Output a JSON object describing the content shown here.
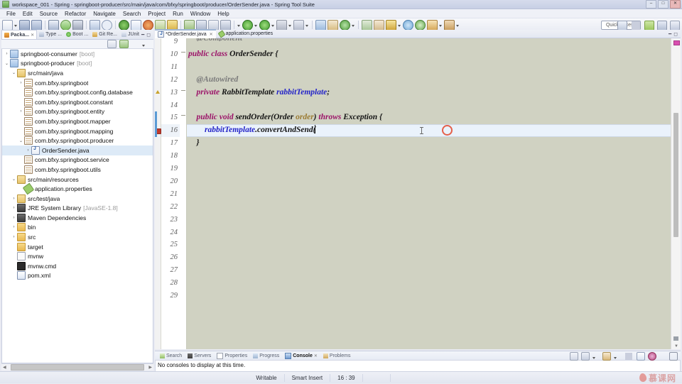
{
  "window": {
    "title": "workspace_001 - Spring - springboot-producer/src/main/java/com/bfxy/springboot/producer/OrderSender.java - Spring Tool Suite",
    "icon": "sts-icon",
    "minimize": "–",
    "maximize": "□",
    "close": "✕"
  },
  "menu": {
    "items": [
      "File",
      "Edit",
      "Source",
      "Refactor",
      "Navigate",
      "Search",
      "Project",
      "Run",
      "Window",
      "Help"
    ]
  },
  "toolbar": {
    "quick_access": "Quick Access"
  },
  "explorer": {
    "tabs": [
      {
        "label": "Packa...",
        "active": true,
        "icon": "package-explorer-icon"
      },
      {
        "label": "Type ...",
        "active": false,
        "icon": "type-hierarchy-icon"
      },
      {
        "label": "Boot ...",
        "active": false,
        "icon": "boot-dashboard-icon"
      },
      {
        "label": "Git Re...",
        "active": false,
        "icon": "git-repositories-icon"
      },
      {
        "label": "JUnit",
        "active": false,
        "icon": "junit-icon"
      }
    ],
    "tree": [
      {
        "indent": 0,
        "twist": "›",
        "icon": "project-icon",
        "label": "springboot-consumer",
        "sub": "[boot]",
        "selected": false
      },
      {
        "indent": 0,
        "twist": "⌄",
        "icon": "project-icon",
        "label": "springboot-producer",
        "sub": "[boot]",
        "selected": false
      },
      {
        "indent": 1,
        "twist": "⌄",
        "icon": "source-folder-icon",
        "label": "src/main/java",
        "sub": "",
        "selected": false
      },
      {
        "indent": 2,
        "twist": "›",
        "icon": "package-icon",
        "label": "com.bfxy.springboot",
        "sub": "",
        "selected": false
      },
      {
        "indent": 2,
        "twist": "",
        "icon": "package-icon",
        "label": "com.bfxy.springboot.config.database",
        "sub": "",
        "selected": false
      },
      {
        "indent": 2,
        "twist": "",
        "icon": "package-icon",
        "label": "com.bfxy.springboot.constant",
        "sub": "",
        "selected": false
      },
      {
        "indent": 2,
        "twist": "›",
        "icon": "package-icon",
        "label": "com.bfxy.springboot.entity",
        "sub": "",
        "selected": false
      },
      {
        "indent": 2,
        "twist": "",
        "icon": "package-icon",
        "label": "com.bfxy.springboot.mapper",
        "sub": "",
        "selected": false
      },
      {
        "indent": 2,
        "twist": "",
        "icon": "package-icon",
        "label": "com.bfxy.springboot.mapping",
        "sub": "",
        "selected": false
      },
      {
        "indent": 2,
        "twist": "⌄",
        "icon": "package-icon",
        "label": "com.bfxy.springboot.producer",
        "sub": "",
        "selected": false
      },
      {
        "indent": 3,
        "twist": "›",
        "icon": "java-file-icon",
        "label": "OrderSender.java",
        "sub": "",
        "selected": true
      },
      {
        "indent": 2,
        "twist": "",
        "icon": "package-icon",
        "label": "com.bfxy.springboot.service",
        "sub": "",
        "selected": false
      },
      {
        "indent": 2,
        "twist": "",
        "icon": "package-icon",
        "label": "com.bfxy.springboot.utils",
        "sub": "",
        "selected": false
      },
      {
        "indent": 1,
        "twist": "⌄",
        "icon": "source-folder-icon",
        "label": "src/main/resources",
        "sub": "",
        "selected": false
      },
      {
        "indent": 2,
        "twist": "",
        "icon": "properties-icon",
        "label": "application.properties",
        "sub": "",
        "selected": false
      },
      {
        "indent": 1,
        "twist": "›",
        "icon": "source-folder-icon",
        "label": "src/test/java",
        "sub": "",
        "selected": false
      },
      {
        "indent": 1,
        "twist": "›",
        "icon": "library-icon",
        "label": "JRE System Library",
        "sub": "[JavaSE-1.8]",
        "selected": false
      },
      {
        "indent": 1,
        "twist": "›",
        "icon": "library-icon",
        "label": "Maven Dependencies",
        "sub": "",
        "selected": false
      },
      {
        "indent": 1,
        "twist": "›",
        "icon": "folder-icon",
        "label": "bin",
        "sub": "",
        "selected": false
      },
      {
        "indent": 1,
        "twist": "›",
        "icon": "folder-icon",
        "label": "src",
        "sub": "",
        "selected": false
      },
      {
        "indent": 1,
        "twist": "",
        "icon": "folder-icon",
        "label": "target",
        "sub": "",
        "selected": false
      },
      {
        "indent": 1,
        "twist": "",
        "icon": "file-icon",
        "label": "mvnw",
        "sub": "",
        "selected": false
      },
      {
        "indent": 1,
        "twist": "",
        "icon": "cmd-file-icon",
        "label": "mvnw.cmd",
        "sub": "",
        "selected": false
      },
      {
        "indent": 1,
        "twist": "",
        "icon": "xml-file-icon",
        "label": "pom.xml",
        "sub": "",
        "selected": false
      }
    ]
  },
  "editor": {
    "tabs": [
      {
        "label": "*OrderSender.java",
        "active": true,
        "dirty": true,
        "icon": "java-file-icon",
        "close": "✕"
      },
      {
        "label": "application.properties",
        "active": false,
        "dirty": false,
        "icon": "properties-icon",
        "close": ""
      }
    ],
    "first_line": 9,
    "lines": [
      {
        "num": "9",
        "clipped": true,
        "tokens": [
          {
            "t": "    @Component",
            "c": "ann"
          }
        ]
      },
      {
        "num": "10",
        "tokens": [
          {
            "t": "public ",
            "c": "kw"
          },
          {
            "t": "class ",
            "c": "kw"
          },
          {
            "t": "OrderSender {",
            "c": "pl"
          }
        ]
      },
      {
        "num": "11",
        "tokens": []
      },
      {
        "num": "12",
        "tokens": [
          {
            "t": "    @Autowired",
            "c": "ann"
          }
        ]
      },
      {
        "num": "13",
        "tokens": [
          {
            "t": "    private ",
            "c": "kw"
          },
          {
            "t": "RabbitTemplate ",
            "c": "pl"
          },
          {
            "t": "rabbitTemplate",
            "c": "fld"
          },
          {
            "t": ";",
            "c": "pl"
          }
        ]
      },
      {
        "num": "14",
        "tokens": []
      },
      {
        "num": "15",
        "tokens": [
          {
            "t": "    public ",
            "c": "kw"
          },
          {
            "t": "void ",
            "c": "kw"
          },
          {
            "t": "sendOrder(Order ",
            "c": "pl"
          },
          {
            "t": "order",
            "c": "par"
          },
          {
            "t": ") ",
            "c": "pl"
          },
          {
            "t": "throws ",
            "c": "kw"
          },
          {
            "t": "Exception {",
            "c": "pl"
          }
        ]
      },
      {
        "num": "16",
        "highlight": true,
        "breakpoint": true,
        "caret": true,
        "tokens": [
          {
            "t": "        ",
            "c": "pl"
          },
          {
            "t": "rabbitTemplate",
            "c": "fld"
          },
          {
            "t": ".convertAndSend(",
            "c": "pl"
          }
        ]
      },
      {
        "num": "17",
        "tokens": [
          {
            "t": "    }",
            "c": "pl"
          }
        ]
      },
      {
        "num": "18",
        "tokens": []
      },
      {
        "num": "19",
        "tokens": []
      },
      {
        "num": "20",
        "tokens": []
      },
      {
        "num": "21",
        "tokens": []
      },
      {
        "num": "22",
        "tokens": []
      },
      {
        "num": "23",
        "tokens": []
      },
      {
        "num": "24",
        "tokens": []
      },
      {
        "num": "25",
        "tokens": []
      },
      {
        "num": "26",
        "tokens": []
      },
      {
        "num": "27",
        "tokens": []
      },
      {
        "num": "28",
        "tokens": []
      },
      {
        "num": "29",
        "tokens": []
      }
    ],
    "background_color": "#d0d2c2",
    "highlight_color": "#eaf2fb"
  },
  "console": {
    "tabs": [
      {
        "label": "Search",
        "active": false,
        "icon": "search-icon"
      },
      {
        "label": "Servers",
        "active": false,
        "icon": "servers-icon"
      },
      {
        "label": "Properties",
        "active": false,
        "icon": "properties-view-icon"
      },
      {
        "label": "Progress",
        "active": false,
        "icon": "progress-icon"
      },
      {
        "label": "Console",
        "active": true,
        "icon": "console-icon"
      },
      {
        "label": "Problems",
        "active": false,
        "icon": "problems-icon"
      }
    ],
    "message": "No consoles to display at this time."
  },
  "status": {
    "writable": "Writable",
    "insert_mode": "Smart Insert",
    "cursor_position": "16 : 39",
    "watermark": "慕课网"
  }
}
